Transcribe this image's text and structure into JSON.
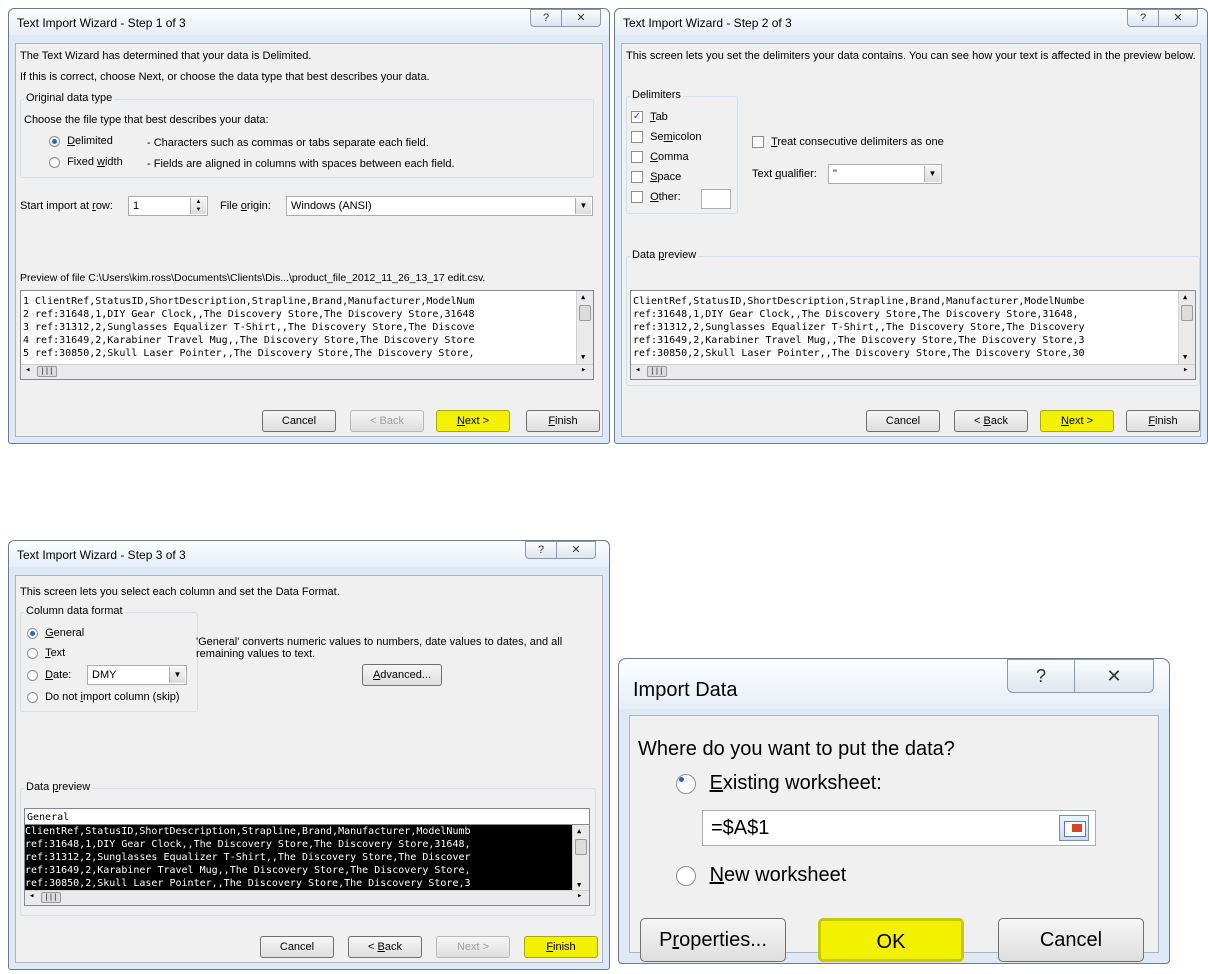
{
  "wizard1": {
    "title": "Text Import Wizard - Step 1 of 3",
    "help_glyph": "?",
    "close_glyph": "✕",
    "intro1": "The Text Wizard has determined that your data is Delimited.",
    "intro2": "If this is correct, choose Next, or choose the data type that best describes your data.",
    "group_label": "Original data type",
    "choose_label": "Choose the file type that best describes your data:",
    "opt_delimited_a": "D",
    "opt_delimited_b": "elimited",
    "opt_delimited_desc": "- Characters such as commas or tabs separate each field.",
    "opt_fixed_a": "Fixed ",
    "opt_fixed_b": "w",
    "opt_fixed_c": "idth",
    "opt_fixed_desc": "- Fields are aligned in columns with spaces between each field.",
    "start_row_a": "Start import at ",
    "start_row_b": "r",
    "start_row_c": "ow:",
    "start_row_value": "1",
    "origin_a": "File ",
    "origin_b": "o",
    "origin_c": "rigin:",
    "origin_value": "Windows (ANSI)",
    "preview_label": "Preview of file C:\\Users\\kim.ross\\Documents\\Clients\\Dis...\\product_file_2012_11_26_13_17 edit.csv.",
    "preview_rows": [
      "1 ClientRef,StatusID,ShortDescription,Strapline,Brand,Manufacturer,ModelNum",
      "2 ref:31648,1,DIY Gear Clock,,The Discovery Store,The Discovery Store,31648",
      "3 ref:31312,2,Sunglasses Equalizer T-Shirt,,The Discovery Store,The Discove",
      "4 ref:31649,2,Karabiner Travel Mug,,The Discovery Store,The Discovery Store",
      "5 ref:30850,2,Skull Laser Pointer,,The Discovery Store,The Discovery Store,"
    ],
    "cancel": "Cancel",
    "back": "< Back",
    "next_a": "N",
    "next_b": "ext >",
    "finish_a": "F",
    "finish_b": "inish"
  },
  "wizard2": {
    "title": "Text Import Wizard - Step 2 of 3",
    "help_glyph": "?",
    "close_glyph": "✕",
    "intro": "This screen lets you set the delimiters your data contains.  You can see how your text is affected in the preview below.",
    "delims_label": "Delimiters",
    "tab_a": "T",
    "tab_b": "ab",
    "semicolon_a": "Se",
    "semicolon_b": "m",
    "semicolon_c": "icolon",
    "comma_a": "C",
    "comma_b": "omma",
    "space_a": "S",
    "space_b": "pace",
    "other_a": "O",
    "other_b": "ther:",
    "check_mark": "✓",
    "consecutive_a": "T",
    "consecutive_b": "reat consecutive delimiters as one",
    "qualifier_a": "Text ",
    "qualifier_b": "q",
    "qualifier_c": "ualifier:",
    "qualifier_value": "\"",
    "preview_label_a": "Data ",
    "preview_label_b": "p",
    "preview_label_c": "review",
    "preview_rows": [
      "ClientRef,StatusID,ShortDescription,Strapline,Brand,Manufacturer,ModelNumbe",
      "ref:31648,1,DIY Gear Clock,,The Discovery Store,The Discovery Store,31648,",
      "ref:31312,2,Sunglasses Equalizer T-Shirt,,The Discovery Store,The Discovery",
      "ref:31649,2,Karabiner Travel Mug,,The Discovery Store,The Discovery Store,3",
      "ref:30850,2,Skull Laser Pointer,,The Discovery Store,The Discovery Store,30"
    ],
    "cancel": "Cancel",
    "back_a": "< ",
    "back_b": "B",
    "back_c": "ack",
    "next_a": "N",
    "next_b": "ext >",
    "finish_a": "F",
    "finish_b": "inish"
  },
  "wizard3": {
    "title": "Text Import Wizard - Step 3 of 3",
    "help_glyph": "?",
    "close_glyph": "✕",
    "intro": "This screen lets you select each column and set the Data Format.",
    "group_label": "Column data format",
    "general_a": "G",
    "general_b": "eneral",
    "text_a": "T",
    "text_b": "ext",
    "date_a": "D",
    "date_b": "ate:",
    "date_value": "DMY",
    "skip_a": "Do not ",
    "skip_b": "i",
    "skip_c": "mport column (skip)",
    "general_desc": "'General' converts numeric values to numbers, date values to dates, and all remaining values to text.",
    "advanced_a": "A",
    "advanced_b": "dvanced...",
    "preview_label_a": "Data ",
    "preview_label_b": "p",
    "preview_label_c": "review",
    "column_header": "General",
    "preview_rows": [
      "ClientRef,StatusID,ShortDescription,Strapline,Brand,Manufacturer,ModelNumb",
      "ref:31648,1,DIY Gear Clock,,The Discovery Store,The Discovery Store,31648,",
      "ref:31312,2,Sunglasses Equalizer T-Shirt,,The Discovery Store,The Discover",
      "ref:31649,2,Karabiner Travel Mug,,The Discovery Store,The Discovery Store,",
      "ref:30850,2,Skull Laser Pointer,,The Discovery Store,The Discovery Store,3"
    ],
    "cancel": "Cancel",
    "back_a": "< ",
    "back_b": "B",
    "back_c": "ack",
    "next": "Next >",
    "finish_a": "F",
    "finish_b": "inish"
  },
  "import": {
    "title": "Import Data",
    "help_glyph": "?",
    "close_glyph": "✕",
    "question": "Where do you want to put the data?",
    "existing_a": "E",
    "existing_b": "xisting worksheet:",
    "ref_value": "=$A$1",
    "new_a": "N",
    "new_b": "ew worksheet",
    "properties_a": "P",
    "properties_b": "r",
    "properties_c": "operties...",
    "ok": "OK",
    "cancel": "Cancel"
  },
  "scroll_glyphs": {
    "up": "▲",
    "down": "▼",
    "left": "◂",
    "right": "▸",
    "grip": "|||"
  }
}
